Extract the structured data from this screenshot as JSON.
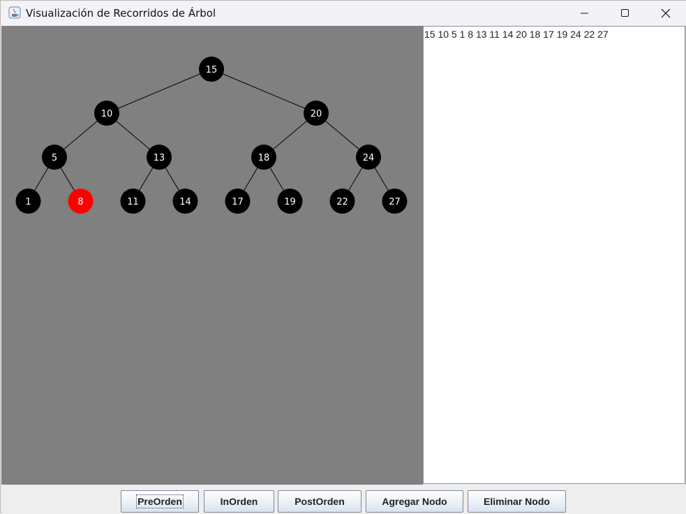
{
  "window": {
    "title": "Visualización de Recorridos de Árbol",
    "controls": [
      "minimize-icon",
      "maximize-icon",
      "close-icon"
    ]
  },
  "tree": {
    "node_color": "#000000",
    "highlight_color": "#ff0000",
    "background": "#808080",
    "highlighted": "8",
    "levels": [
      [
        "15"
      ],
      [
        "10",
        "20"
      ],
      [
        "5",
        "13",
        "18",
        "24"
      ],
      [
        "1",
        "8",
        "11",
        "14",
        "17",
        "19",
        "22",
        "27"
      ]
    ]
  },
  "output": {
    "text": "15 10 5 1 8 13 11 14 20 18 17 19 24 22 27"
  },
  "buttons": {
    "preorden": "PreOrden",
    "inorden": "InOrden",
    "postorden": "PostOrden",
    "agregar": "Agregar Nodo",
    "eliminar": "Eliminar Nodo"
  }
}
